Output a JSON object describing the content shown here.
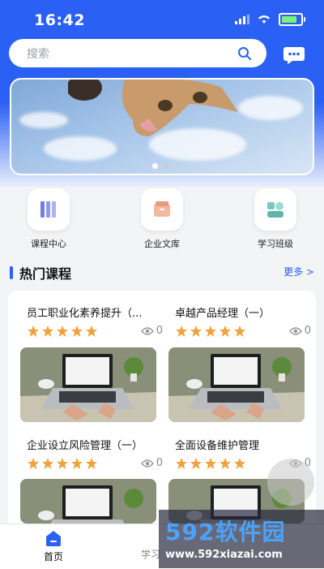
{
  "status_bar": {
    "time": "16:42"
  },
  "search": {
    "placeholder": "搜索"
  },
  "quick_links": [
    {
      "label": "课程中心"
    },
    {
      "label": "企业文库"
    },
    {
      "label": "学习班级"
    }
  ],
  "section": {
    "title": "热门课程",
    "more": "更多 >"
  },
  "courses": [
    {
      "title": "员工职业化素养提升（...",
      "rating": 5,
      "views": "0"
    },
    {
      "title": "卓越产品经理（一）",
      "rating": 5,
      "views": "0"
    },
    {
      "title": "企业设立风险管理（一）",
      "rating": 5,
      "views": "0"
    },
    {
      "title": "全面设备维护管理",
      "rating": 5,
      "views": "0"
    }
  ],
  "tabbar": {
    "home": "首页",
    "study": "学习"
  },
  "watermark": {
    "logo": "592软件园",
    "url": "www.592xiazai.com"
  },
  "colors": {
    "primary": "#2b60f4",
    "star": "#f0a23c"
  },
  "icons": [
    "search-icon",
    "chat-icon",
    "books-icon",
    "box-icon",
    "class-icon",
    "star-icon",
    "eye-icon",
    "home-icon"
  ]
}
